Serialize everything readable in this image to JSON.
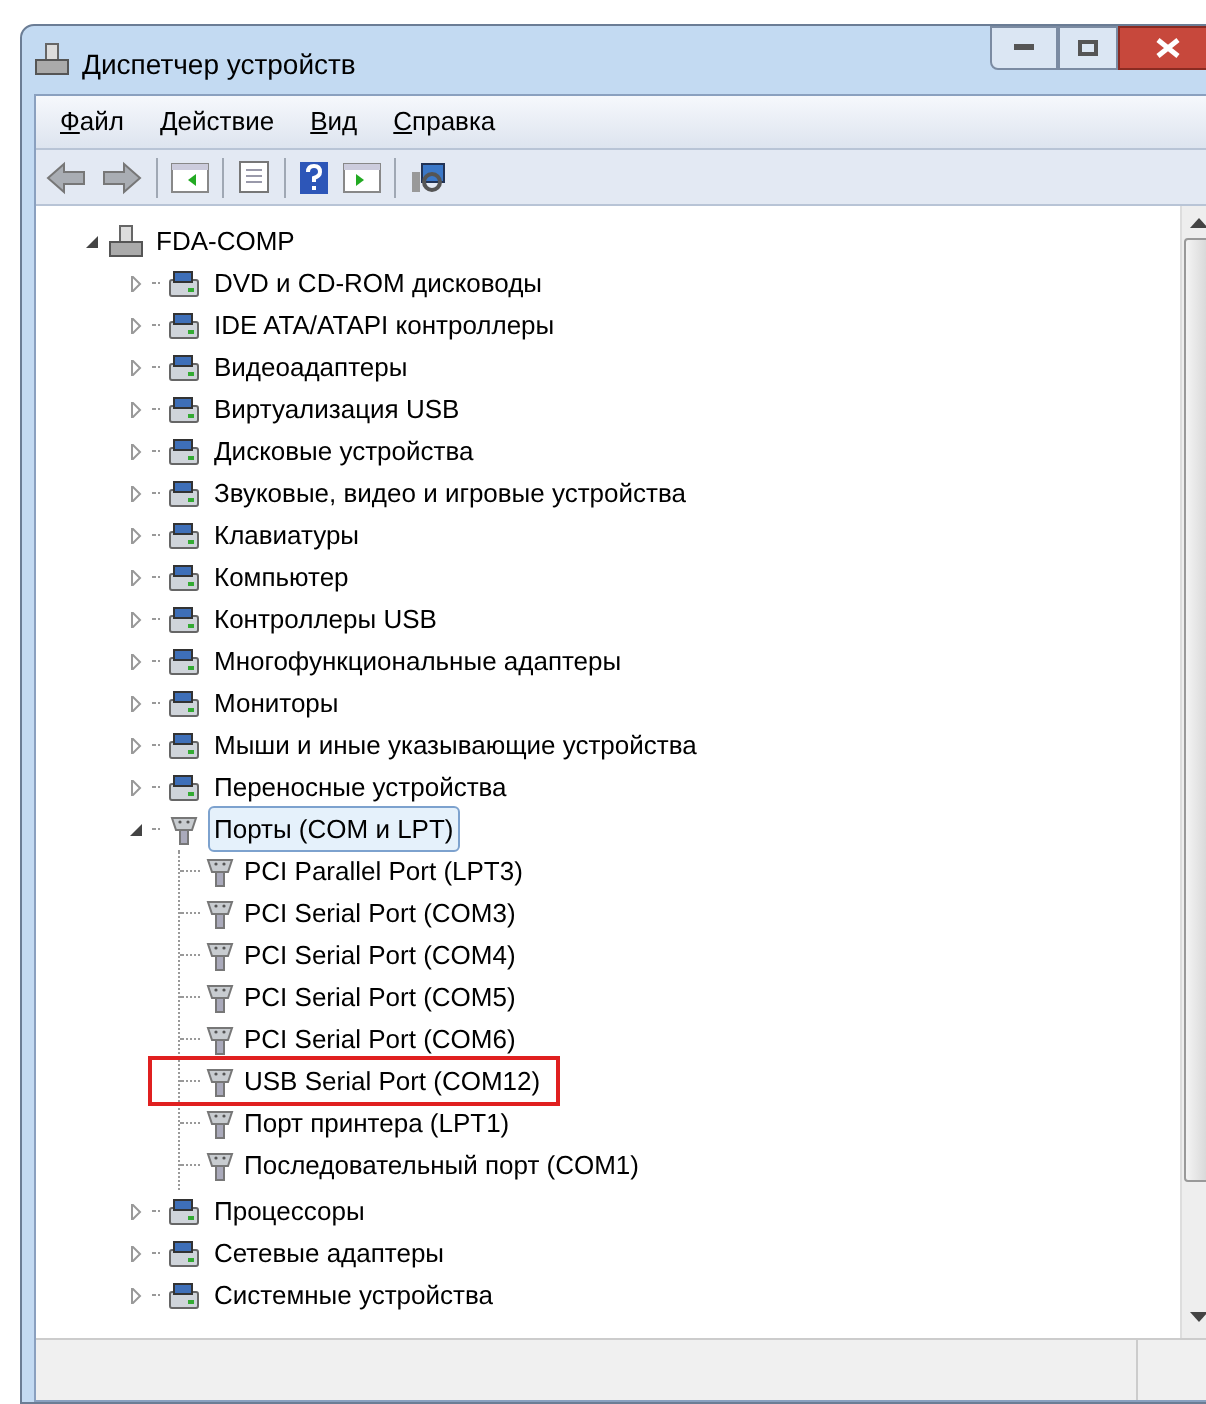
{
  "window": {
    "title": "Диспетчер устройств"
  },
  "menu": [
    "Файл",
    "Действие",
    "Вид",
    "Справка"
  ],
  "tree": {
    "label": "FDA-COMP",
    "expanded": true,
    "children": [
      {
        "label": "DVD и CD-ROM дисководы",
        "expanded": false,
        "selected": false
      },
      {
        "label": "IDE ATA/ATAPI контроллеры",
        "expanded": false,
        "selected": false
      },
      {
        "label": "Видеоадаптеры",
        "expanded": false,
        "selected": false
      },
      {
        "label": "Виртуализация USB",
        "expanded": false,
        "selected": false
      },
      {
        "label": "Дисковые устройства",
        "expanded": false,
        "selected": false
      },
      {
        "label": "Звуковые, видео и игровые устройства",
        "expanded": false,
        "selected": false
      },
      {
        "label": "Клавиатуры",
        "expanded": false,
        "selected": false
      },
      {
        "label": "Компьютер",
        "expanded": false,
        "selected": false
      },
      {
        "label": "Контроллеры USB",
        "expanded": false,
        "selected": false
      },
      {
        "label": "Многофункциональные адаптеры",
        "expanded": false,
        "selected": false
      },
      {
        "label": "Мониторы",
        "expanded": false,
        "selected": false
      },
      {
        "label": "Мыши и иные указывающие устройства",
        "expanded": false,
        "selected": false
      },
      {
        "label": "Переносные устройства",
        "expanded": false,
        "selected": false
      },
      {
        "label": "Порты (COM и LPT)",
        "expanded": true,
        "selected": true,
        "children": [
          {
            "label": "PCI Parallel Port (LPT3)",
            "highlighted": false
          },
          {
            "label": "PCI Serial Port (COM3)",
            "highlighted": false
          },
          {
            "label": "PCI Serial Port (COM4)",
            "highlighted": false
          },
          {
            "label": "PCI Serial Port (COM5)",
            "highlighted": false
          },
          {
            "label": "PCI Serial Port (COM6)",
            "highlighted": false
          },
          {
            "label": "USB Serial Port (COM12)",
            "highlighted": true
          },
          {
            "label": "Порт принтера (LPT1)",
            "highlighted": false
          },
          {
            "label": "Последовательный порт (COM1)",
            "highlighted": false
          }
        ]
      },
      {
        "label": "Процессоры",
        "expanded": false,
        "selected": false
      },
      {
        "label": "Сетевые адаптеры",
        "expanded": false,
        "selected": false
      },
      {
        "label": "Системные устройства",
        "expanded": false,
        "selected": false
      }
    ]
  }
}
